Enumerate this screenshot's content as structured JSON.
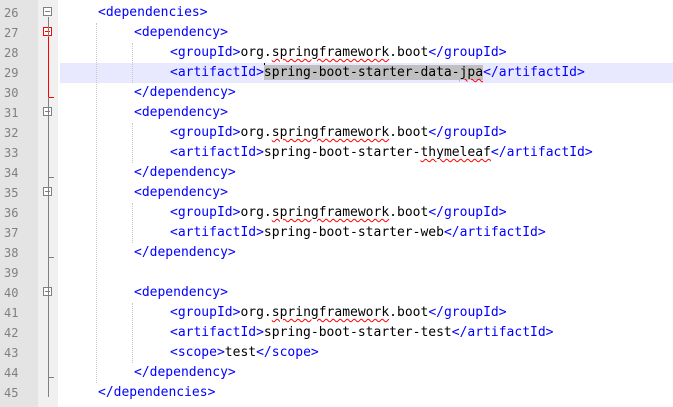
{
  "editor": {
    "lines": [
      {
        "num": "26",
        "parts": [
          {
            "t": "tag",
            "v": "<dependencies>"
          }
        ]
      },
      {
        "num": "27",
        "parts": [
          {
            "t": "tag",
            "v": "<dependency>"
          }
        ]
      },
      {
        "num": "28",
        "parts": [
          {
            "t": "tag",
            "v": "<groupId>"
          },
          {
            "t": "text",
            "v": "org."
          },
          {
            "t": "sq",
            "v": "springframework"
          },
          {
            "t": "text",
            "v": ".boot"
          },
          {
            "t": "tag",
            "v": "</groupId>"
          }
        ]
      },
      {
        "num": "29",
        "parts": [
          {
            "t": "tag",
            "v": "<artifactId>"
          },
          {
            "t": "caret",
            "v": ""
          },
          {
            "t": "sel",
            "v": "spring-boot-starter-data-"
          },
          {
            "t": "selsq",
            "v": "jpa"
          },
          {
            "t": "tag",
            "v": "</artifactId>"
          }
        ]
      },
      {
        "num": "30",
        "parts": [
          {
            "t": "tag",
            "v": "</dependency>"
          }
        ]
      },
      {
        "num": "31",
        "parts": [
          {
            "t": "tag",
            "v": "<dependency>"
          }
        ]
      },
      {
        "num": "32",
        "parts": [
          {
            "t": "tag",
            "v": "<groupId>"
          },
          {
            "t": "text",
            "v": "org."
          },
          {
            "t": "sq",
            "v": "springframework"
          },
          {
            "t": "text",
            "v": ".boot"
          },
          {
            "t": "tag",
            "v": "</groupId>"
          }
        ]
      },
      {
        "num": "33",
        "parts": [
          {
            "t": "tag",
            "v": "<artifactId>"
          },
          {
            "t": "text",
            "v": "spring-boot-starter-"
          },
          {
            "t": "sq",
            "v": "thymeleaf"
          },
          {
            "t": "tag",
            "v": "</artifactId>"
          }
        ]
      },
      {
        "num": "34",
        "parts": [
          {
            "t": "tag",
            "v": "</dependency>"
          }
        ]
      },
      {
        "num": "35",
        "parts": [
          {
            "t": "tag",
            "v": "<dependency>"
          }
        ]
      },
      {
        "num": "36",
        "parts": [
          {
            "t": "tag",
            "v": "<groupId>"
          },
          {
            "t": "text",
            "v": "org."
          },
          {
            "t": "sq",
            "v": "springframework"
          },
          {
            "t": "text",
            "v": ".boot"
          },
          {
            "t": "tag",
            "v": "</groupId>"
          }
        ]
      },
      {
        "num": "37",
        "parts": [
          {
            "t": "tag",
            "v": "<artifactId>"
          },
          {
            "t": "text",
            "v": "spring-boot-starter-web"
          },
          {
            "t": "tag",
            "v": "</artifactId>"
          }
        ]
      },
      {
        "num": "38",
        "parts": [
          {
            "t": "tag",
            "v": "</dependency>"
          }
        ]
      },
      {
        "num": "39",
        "parts": []
      },
      {
        "num": "40",
        "parts": [
          {
            "t": "tag",
            "v": "<dependency>"
          }
        ]
      },
      {
        "num": "41",
        "parts": [
          {
            "t": "tag",
            "v": "<groupId>"
          },
          {
            "t": "text",
            "v": "org."
          },
          {
            "t": "sq",
            "v": "springframework"
          },
          {
            "t": "text",
            "v": ".boot"
          },
          {
            "t": "tag",
            "v": "</groupId>"
          }
        ]
      },
      {
        "num": "42",
        "parts": [
          {
            "t": "tag",
            "v": "<artifactId>"
          },
          {
            "t": "text",
            "v": "spring-boot-starter-test"
          },
          {
            "t": "tag",
            "v": "</artifactId>"
          }
        ]
      },
      {
        "num": "43",
        "parts": [
          {
            "t": "tag",
            "v": "<scope>"
          },
          {
            "t": "text",
            "v": "test"
          },
          {
            "t": "tag",
            "v": "</scope>"
          }
        ]
      },
      {
        "num": "44",
        "parts": [
          {
            "t": "tag",
            "v": "</dependency>"
          }
        ]
      },
      {
        "num": "45",
        "parts": [
          {
            "t": "tag",
            "v": "</dependencies>"
          }
        ]
      }
    ],
    "current_line": "29",
    "colors": {
      "tag": "#0000ff",
      "text": "#000000",
      "line_number": "#808080",
      "selection": "#c0c0c0",
      "fold_marker_active": "#ff0000",
      "gutter": "#e4e4e4"
    }
  }
}
